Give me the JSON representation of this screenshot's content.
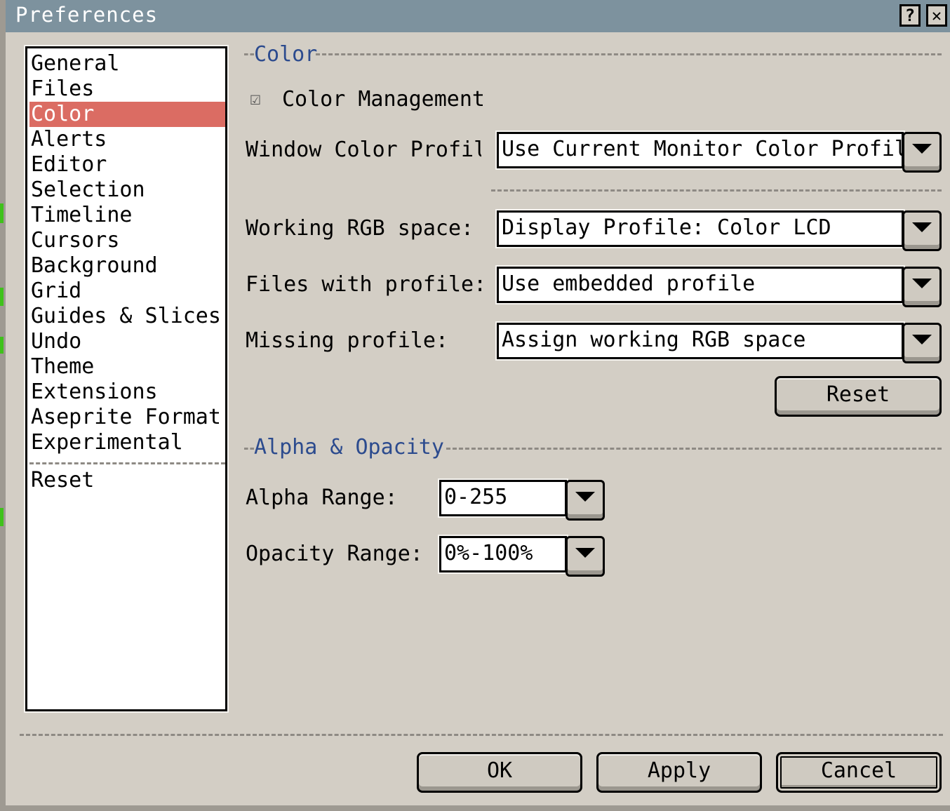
{
  "window": {
    "title": "Preferences",
    "help_label": "?",
    "close_label": "✕"
  },
  "sidebar": {
    "items": [
      {
        "label": "General"
      },
      {
        "label": "Files"
      },
      {
        "label": "Color"
      },
      {
        "label": "Alerts"
      },
      {
        "label": "Editor"
      },
      {
        "label": "Selection"
      },
      {
        "label": "Timeline"
      },
      {
        "label": "Cursors"
      },
      {
        "label": "Background"
      },
      {
        "label": "Grid"
      },
      {
        "label": "Guides & Slices"
      },
      {
        "label": "Undo"
      },
      {
        "label": "Theme"
      },
      {
        "label": "Extensions"
      },
      {
        "label": "Aseprite Format"
      },
      {
        "label": "Experimental"
      }
    ],
    "selected": "Color",
    "reset_label": "Reset",
    "selection_color": "#db6c63"
  },
  "color_section": {
    "title": "Color",
    "color_management_label": "Color Management",
    "color_management_checked": true,
    "window_profile_label": "Window Color Profile",
    "window_profile_value": "Use Current Monitor Color Profile",
    "working_rgb_label": "Working RGB space:",
    "working_rgb_value": "Display Profile: Color LCD",
    "files_with_profile_label": "Files with profile:",
    "files_with_profile_value": "Use embedded profile",
    "missing_profile_label": "Missing profile:",
    "missing_profile_value": "Assign working RGB space",
    "reset_label": "Reset"
  },
  "alpha_section": {
    "title": "Alpha & Opacity",
    "alpha_range_label": "Alpha Range:",
    "alpha_range_value": "0-255",
    "opacity_range_label": "Opacity Range:",
    "opacity_range_value": "0%-100%"
  },
  "footer": {
    "ok_label": "OK",
    "apply_label": "Apply",
    "cancel_label": "Cancel"
  },
  "colors": {
    "title_bar": "#7d929e",
    "section_title": "#2c4b8e",
    "window_bg": "#d3cec5"
  }
}
